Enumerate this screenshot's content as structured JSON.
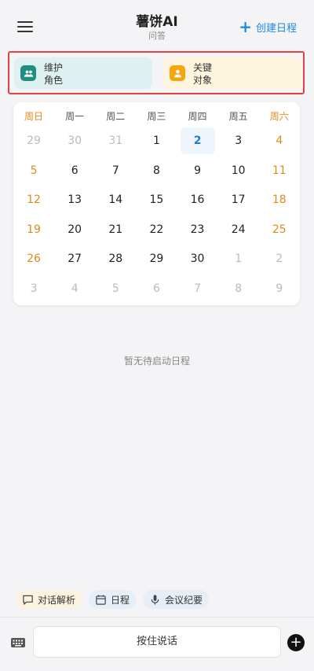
{
  "header": {
    "title": "薯饼AI",
    "subtitle": "问答",
    "create_label": "创建日程",
    "create_icon": "plus-icon",
    "menu_icon": "hamburger-menu-icon"
  },
  "quick_cards": [
    {
      "line1": "维护",
      "line2": "角色",
      "icon": "group-icon",
      "color": "#1f8f84"
    },
    {
      "line1": "关键",
      "line2": "对象",
      "icon": "person-icon",
      "color": "#f5a60e"
    }
  ],
  "calendar": {
    "weekdays": [
      "周日",
      "周一",
      "周二",
      "周三",
      "周四",
      "周五",
      "周六"
    ],
    "weeks": [
      [
        "29",
        "30",
        "31",
        "1",
        "2",
        "3",
        "4"
      ],
      [
        "5",
        "6",
        "7",
        "8",
        "9",
        "10",
        "11"
      ],
      [
        "12",
        "13",
        "14",
        "15",
        "16",
        "17",
        "18"
      ],
      [
        "19",
        "20",
        "21",
        "22",
        "23",
        "24",
        "25"
      ],
      [
        "26",
        "27",
        "28",
        "29",
        "30",
        "1",
        "2"
      ],
      [
        "3",
        "4",
        "5",
        "6",
        "7",
        "8",
        "9"
      ]
    ],
    "today": "2",
    "weekend_color": "#e08a1a",
    "today_color": "#1e7dd0"
  },
  "empty_text": "暂无待启动日程",
  "chips": [
    {
      "label": "对话解析",
      "icon": "chat-icon"
    },
    {
      "label": "日程",
      "icon": "calendar-icon"
    },
    {
      "label": "会议纪要",
      "icon": "microphone-icon"
    }
  ],
  "input_bar": {
    "hold_to_talk": "按住说话",
    "keyboard_icon": "keyboard-icon",
    "add_icon": "plus-circle-icon"
  }
}
